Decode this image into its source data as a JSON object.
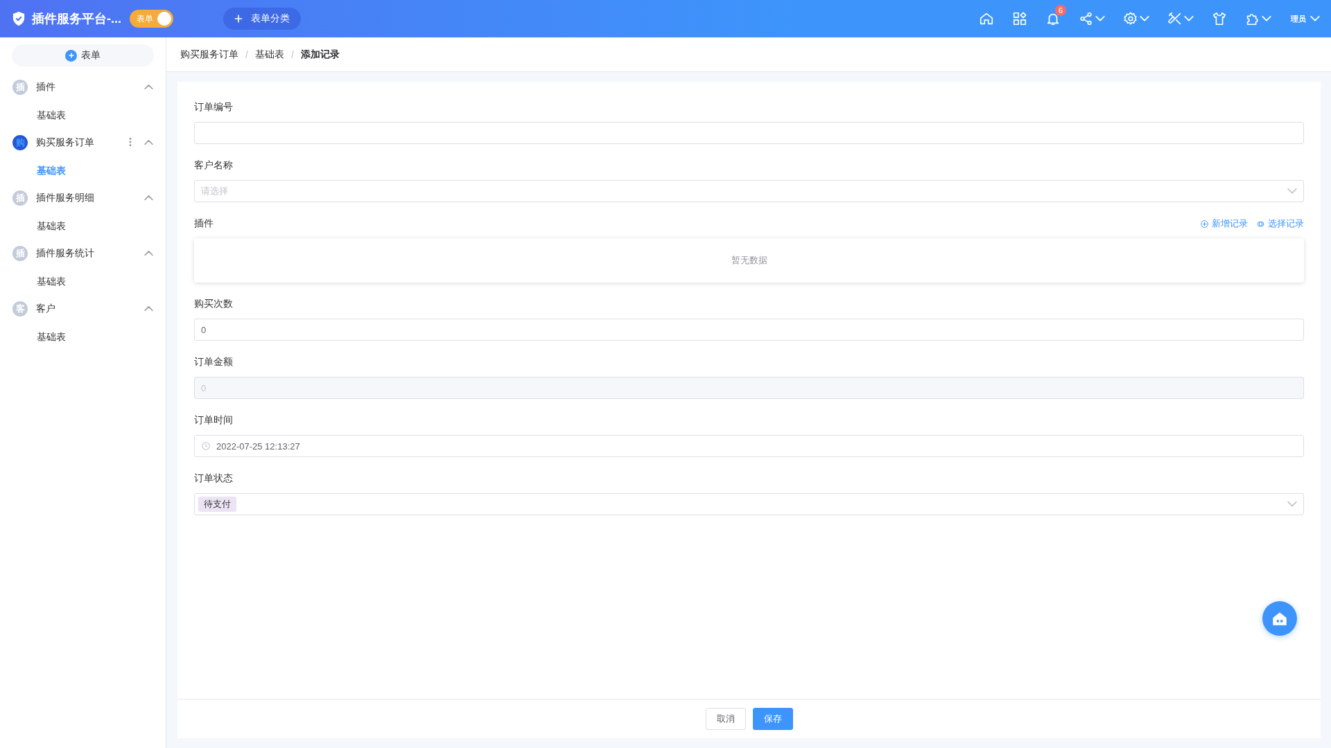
{
  "header": {
    "title": "插件服务平台-...",
    "toggle": {
      "label": "表单",
      "on": true
    },
    "category_button": "表单分类",
    "icons": [
      {
        "kind": "home",
        "dropdown": false
      },
      {
        "kind": "apps",
        "dropdown": false
      },
      {
        "kind": "bell",
        "dropdown": false,
        "badge": "6"
      },
      {
        "kind": "share",
        "dropdown": true
      },
      {
        "kind": "gear",
        "dropdown": true
      },
      {
        "kind": "tools",
        "dropdown": true
      },
      {
        "kind": "shirt",
        "dropdown": false
      },
      {
        "kind": "puzzle",
        "dropdown": true
      }
    ],
    "user": {
      "avatar": "理员"
    }
  },
  "sidebar": {
    "add_button": "表单",
    "groups": [
      {
        "avatar": "插",
        "name": "插件",
        "active": false,
        "expanded": true,
        "children": [
          {
            "label": "基础表",
            "selected": false
          }
        ]
      },
      {
        "avatar": "购",
        "name": "购买服务订单",
        "active": true,
        "expanded": true,
        "children": [
          {
            "label": "基础表",
            "selected": true
          }
        ]
      },
      {
        "avatar": "插",
        "name": "插件服务明细",
        "active": false,
        "expanded": true,
        "children": [
          {
            "label": "基础表",
            "selected": false
          }
        ]
      },
      {
        "avatar": "插",
        "name": "插件服务统计",
        "active": false,
        "expanded": true,
        "children": [
          {
            "label": "基础表",
            "selected": false
          }
        ]
      },
      {
        "avatar": "客",
        "name": "客户",
        "active": false,
        "expanded": true,
        "children": [
          {
            "label": "基础表",
            "selected": false
          }
        ]
      }
    ]
  },
  "breadcrumb": {
    "separator": "/",
    "items": [
      "购买服务订单",
      "基础表",
      "添加记录"
    ]
  },
  "form": {
    "fields": [
      {
        "kind": "text",
        "label": "订单编号"
      },
      {
        "kind": "select",
        "label": "客户名称",
        "placeholder": "请选择"
      },
      {
        "kind": "subtable",
        "label": "插件",
        "actions": [
          "新增记录",
          "选择记录"
        ],
        "empty": "暂无数据"
      },
      {
        "kind": "text",
        "label": "购买次数",
        "value": "0"
      },
      {
        "kind": "disabled",
        "label": "订单金额",
        "value": "0"
      },
      {
        "kind": "datetime",
        "label": "订单时间",
        "value": "2022-07-25 12:13:27"
      },
      {
        "kind": "tagselect",
        "label": "订单状态",
        "tag": "待支付"
      }
    ],
    "buttons": [
      {
        "label": "取消",
        "primary": false
      },
      {
        "label": "保存",
        "primary": true
      }
    ]
  }
}
